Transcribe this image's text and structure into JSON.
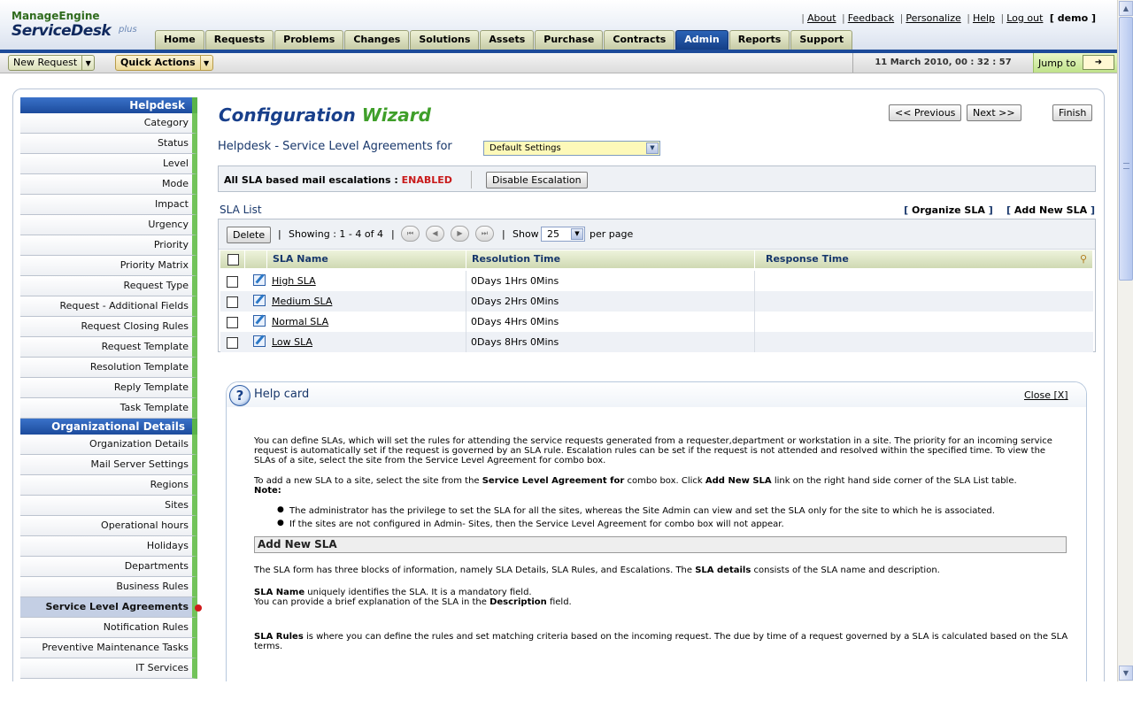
{
  "app": {
    "brand_top": "ManageEngine",
    "brand_main": "ServiceDesk",
    "brand_plus": "plus"
  },
  "toplinks": {
    "about": "About",
    "feedback": "Feedback",
    "personalize": "Personalize",
    "help": "Help",
    "logout": "Log out",
    "user": "[ demo ]"
  },
  "tabs": [
    "Home",
    "Requests",
    "Problems",
    "Changes",
    "Solutions",
    "Assets",
    "Purchase",
    "Contracts",
    "Admin",
    "Reports",
    "Support"
  ],
  "active_tab": "Admin",
  "toolbar": {
    "new_request": "New Request",
    "quick_actions": "Quick Actions",
    "datetime": "11 March 2010, 00 : 32 : 57",
    "jump_to": "Jump to"
  },
  "sidebar": {
    "helpdesk_header": "Helpdesk",
    "helpdesk_items": [
      "Category",
      "Status",
      "Level",
      "Mode",
      "Impact",
      "Urgency",
      "Priority",
      "Priority Matrix",
      "Request Type",
      "Request - Additional Fields",
      "Request Closing Rules",
      "Request Template",
      "Resolution Template",
      "Reply Template",
      "Task Template"
    ],
    "org_header": "Organizational Details",
    "org_items": [
      "Organization Details",
      "Mail Server Settings",
      "Regions",
      "Sites",
      "Operational hours",
      "Holidays",
      "Departments",
      "Business Rules",
      "Service Level Agreements",
      "Notification Rules",
      "Preventive Maintenance Tasks",
      "IT Services"
    ],
    "active_item": "Service Level Agreements"
  },
  "wizard": {
    "title_a": "Configuration",
    "title_b": "Wizard",
    "prev": "<< Previous",
    "next": "Next >>",
    "finish": "Finish"
  },
  "page": {
    "heading": "Helpdesk - Service Level Agreements for",
    "site_value": "Default Settings",
    "escalation_label": "All SLA based mail escalations : ",
    "escalation_status": "ENABLED",
    "disable_button": "Disable Escalation",
    "list_title": "SLA List",
    "organize": "Organize SLA",
    "add_new": "Add New SLA"
  },
  "pager": {
    "delete": "Delete",
    "showing": "Showing : 1 - 4 of 4",
    "show": "Show",
    "per_page_value": "25",
    "per_page": "per page"
  },
  "table": {
    "columns": [
      "SLA Name",
      "Resolution Time",
      "Response Time"
    ],
    "rows": [
      {
        "name": "High SLA",
        "resolution": "0Days 1Hrs 0Mins",
        "response": ""
      },
      {
        "name": "Medium SLA",
        "resolution": "0Days 2Hrs 0Mins",
        "response": ""
      },
      {
        "name": "Normal SLA",
        "resolution": "0Days 4Hrs 0Mins",
        "response": ""
      },
      {
        "name": "Low SLA",
        "resolution": "0Days 8Hrs 0Mins",
        "response": ""
      }
    ]
  },
  "help": {
    "title": "Help card",
    "close": "Close  [X]",
    "p1": "You can define SLAs, which will set the rules for attending the service requests generated from a requester,department or workstation in a site. The priority for an incoming service request is automatically set if the request is governed by an SLA rule. Escalation rules can be set if the request is not attended and resolved within the specified time. To view the SLAs of a site, select the site from the Service Level Agreement for combo box.",
    "p2_a": "To add a new SLA to a site, select the site from the ",
    "p2_b": "Service Level Agreement for",
    "p2_c": " combo box. Click ",
    "p2_d": "Add New SLA",
    "p2_e": " link on the right hand side corner of the SLA List table.",
    "note": "Note:",
    "bullets": [
      "The administrator has the privilege to set the SLA for all the sites, whereas the Site Admin can view and set the SLA only for the site to which he is associated.",
      "If the sites are not configured in Admin- Sites, then the Service Level Agreement for combo box will not appear."
    ],
    "section": "Add New SLA",
    "p3_a": "The SLA form has three blocks of information, namely SLA Details, SLA Rules, and Escalations. The ",
    "p3_b": "SLA details",
    "p3_c": " consists of the SLA name and description.",
    "p4_a": "SLA Name",
    "p4_b": " uniquely identifies the SLA. It is a mandatory field.",
    "p4_c": "You can provide a brief explanation of the SLA in the ",
    "p4_d": "Description",
    "p4_e": " field.",
    "p5_a": "SLA Rules",
    "p5_b": " is where you can define the rules and set matching criteria based on the incoming request. The due by time of a request governed by a SLA is calculated based on the SLA terms."
  },
  "colors": {
    "accent_blue": "#1c4a99",
    "wizard_green": "#3f9f2a",
    "enabled_red": "#c81a1a"
  }
}
